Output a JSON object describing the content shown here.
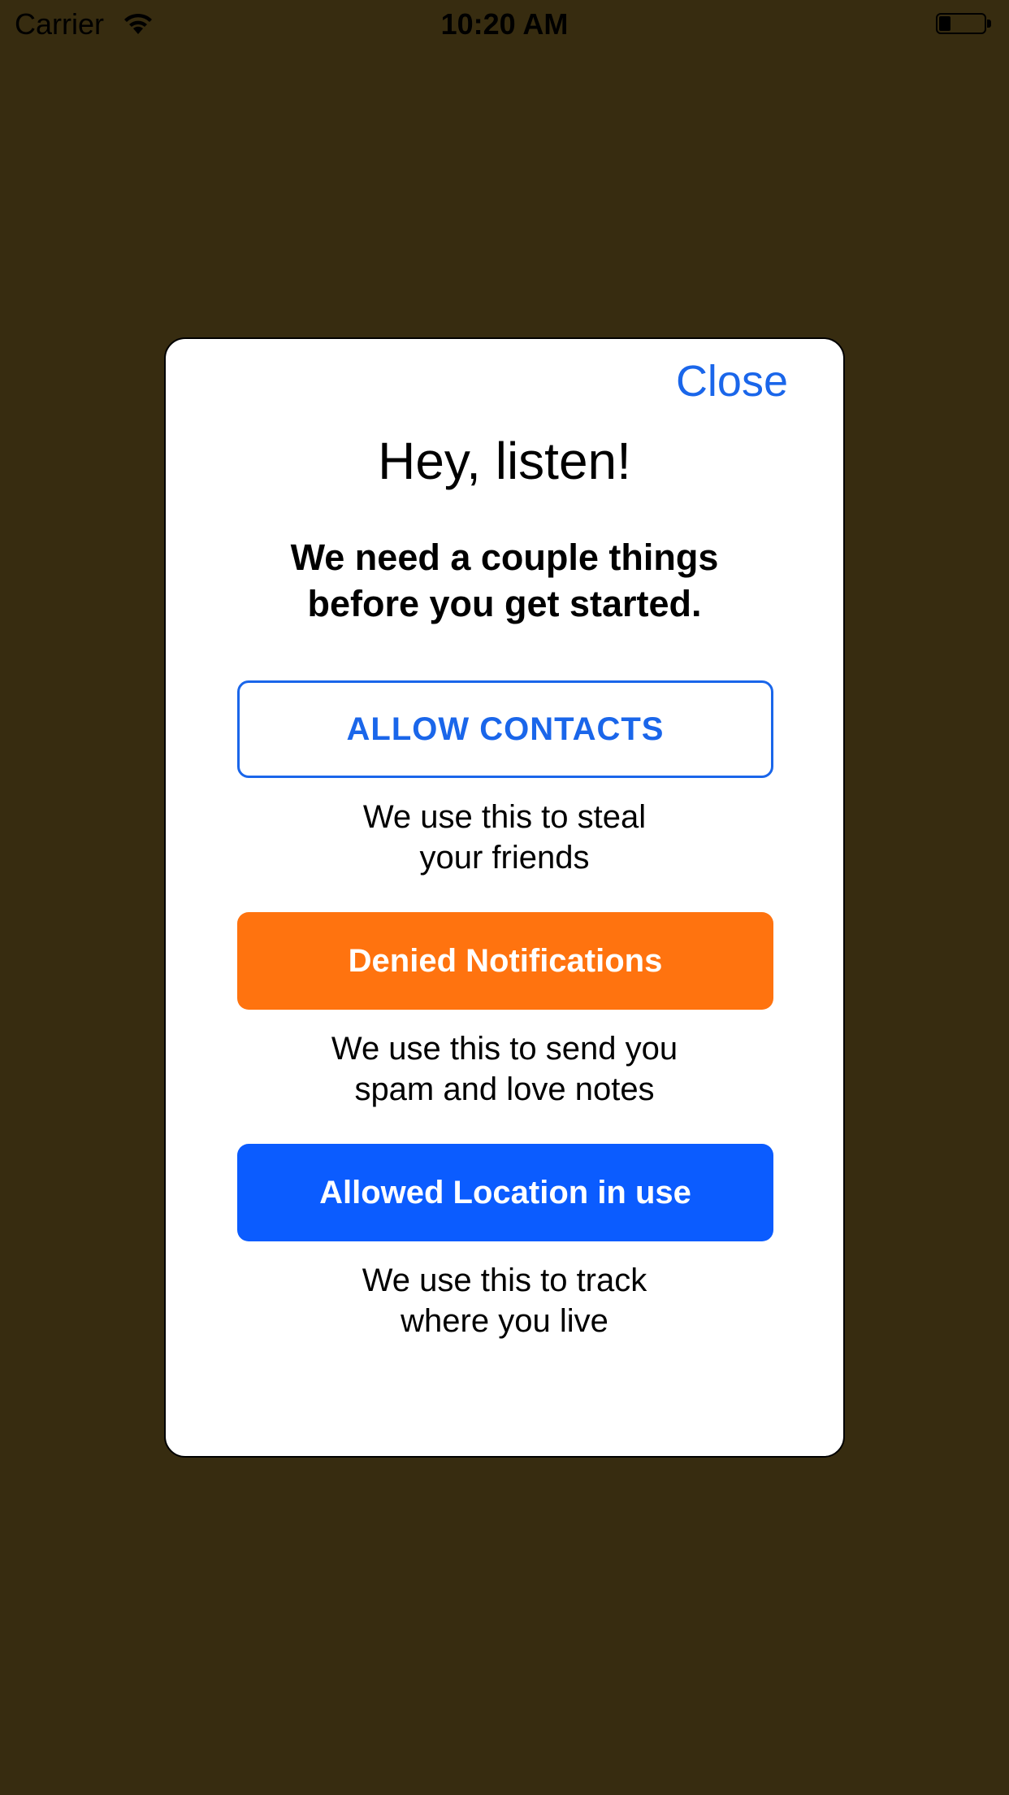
{
  "status_bar": {
    "carrier": "Carrier",
    "time": "10:20 AM",
    "battery_level": 0.25,
    "icons": [
      "wifi-icon",
      "battery-icon"
    ]
  },
  "modal": {
    "close_label": "Close",
    "title": "Hey, listen!",
    "subtitle": "We need a couple things before you get started.",
    "permissions": [
      {
        "button_label": "ALLOW CONTACTS",
        "description": "We use this to steal\nyour friends",
        "state": "not-determined"
      },
      {
        "button_label": "Denied Notifications",
        "description": "We use this to send you\nspam and love notes",
        "state": "denied"
      },
      {
        "button_label": "Allowed Location in use",
        "description": "We use this to track\nwhere you live",
        "state": "allowed"
      }
    ]
  },
  "colors": {
    "background": "#372c10",
    "accent_blue": "#1a66ea",
    "allowed_blue": "#0b5cff",
    "denied_orange": "#ff730f",
    "modal_bg": "#ffffff"
  }
}
